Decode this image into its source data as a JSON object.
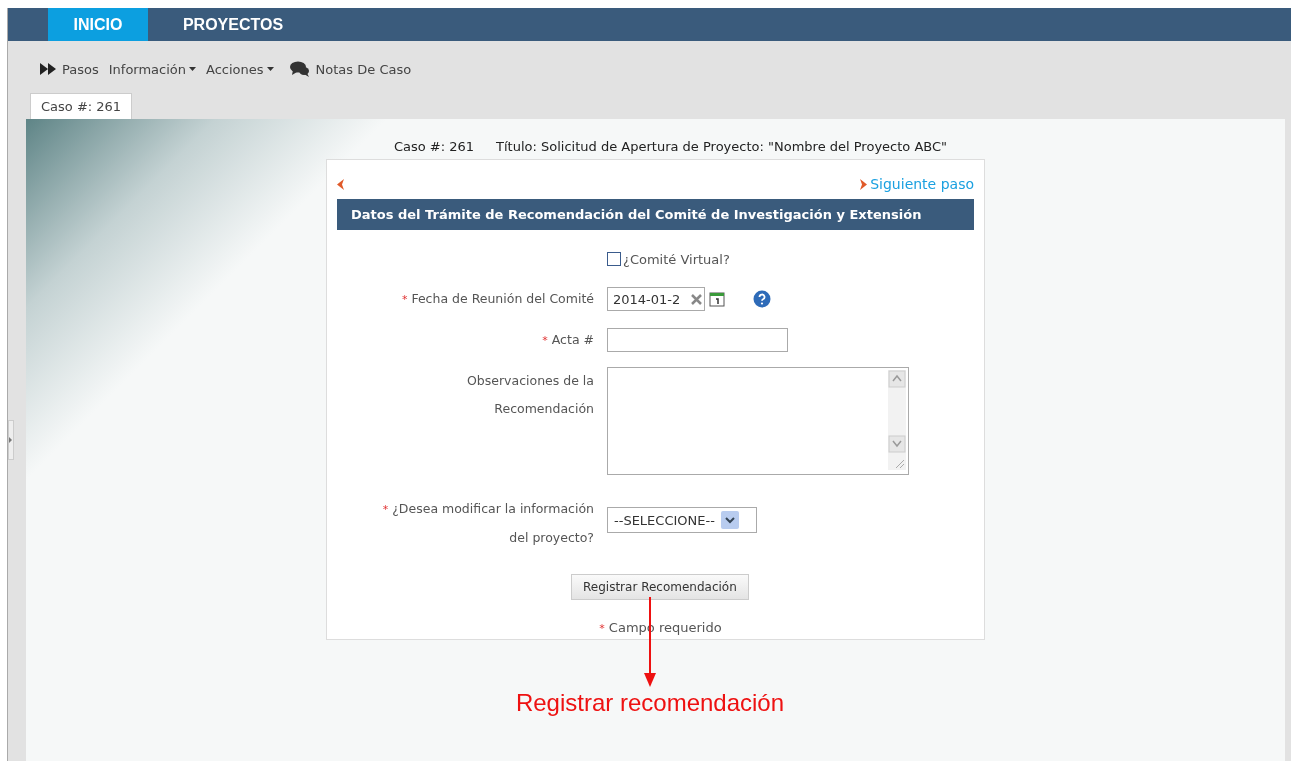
{
  "nav_tabs": [
    {
      "label": "INICIO",
      "selected": true
    },
    {
      "label": "PROYECTOS",
      "selected": false
    }
  ],
  "toolbar": [
    {
      "kind": "steps",
      "label": "Pasos"
    },
    {
      "kind": "dropdown",
      "label": "Información"
    },
    {
      "kind": "dropdown",
      "label": "Acciones"
    },
    {
      "kind": "notes",
      "label": "Notas De Caso"
    }
  ],
  "case_tab": {
    "label": "Caso #: 261",
    "selected": true
  },
  "case_header": {
    "case": "Caso #: 261",
    "title": "Título: Solicitud de Apertura de Proyecto: \"Nombre del Proyecto ABC\""
  },
  "form": {
    "next_step": "Siguiente paso",
    "section_title": "Datos del Trámite de Recomendación del Comité de Investigación y Extensión",
    "fields": [
      {
        "kind": "checkbox",
        "label": "¿Comité Virtual?",
        "checked": false
      },
      {
        "kind": "date",
        "marker": "*",
        "label": "Fecha de Reunión del Comité",
        "value": "2014-01-2"
      },
      {
        "kind": "text",
        "marker": "*",
        "label": "Acta #"
      },
      {
        "kind": "textarea",
        "label": "Observaciones de la Recomendación"
      },
      {
        "kind": "select",
        "marker": "*",
        "label": "¿Desea modificar la información del proyecto?",
        "value": "--SELECCIONE--"
      }
    ],
    "submit": "Registrar Recomendación",
    "footnote": {
      "marker": "*",
      "text": "Campo requerido"
    }
  },
  "annotation": {
    "text": "Registrar recomendación"
  }
}
